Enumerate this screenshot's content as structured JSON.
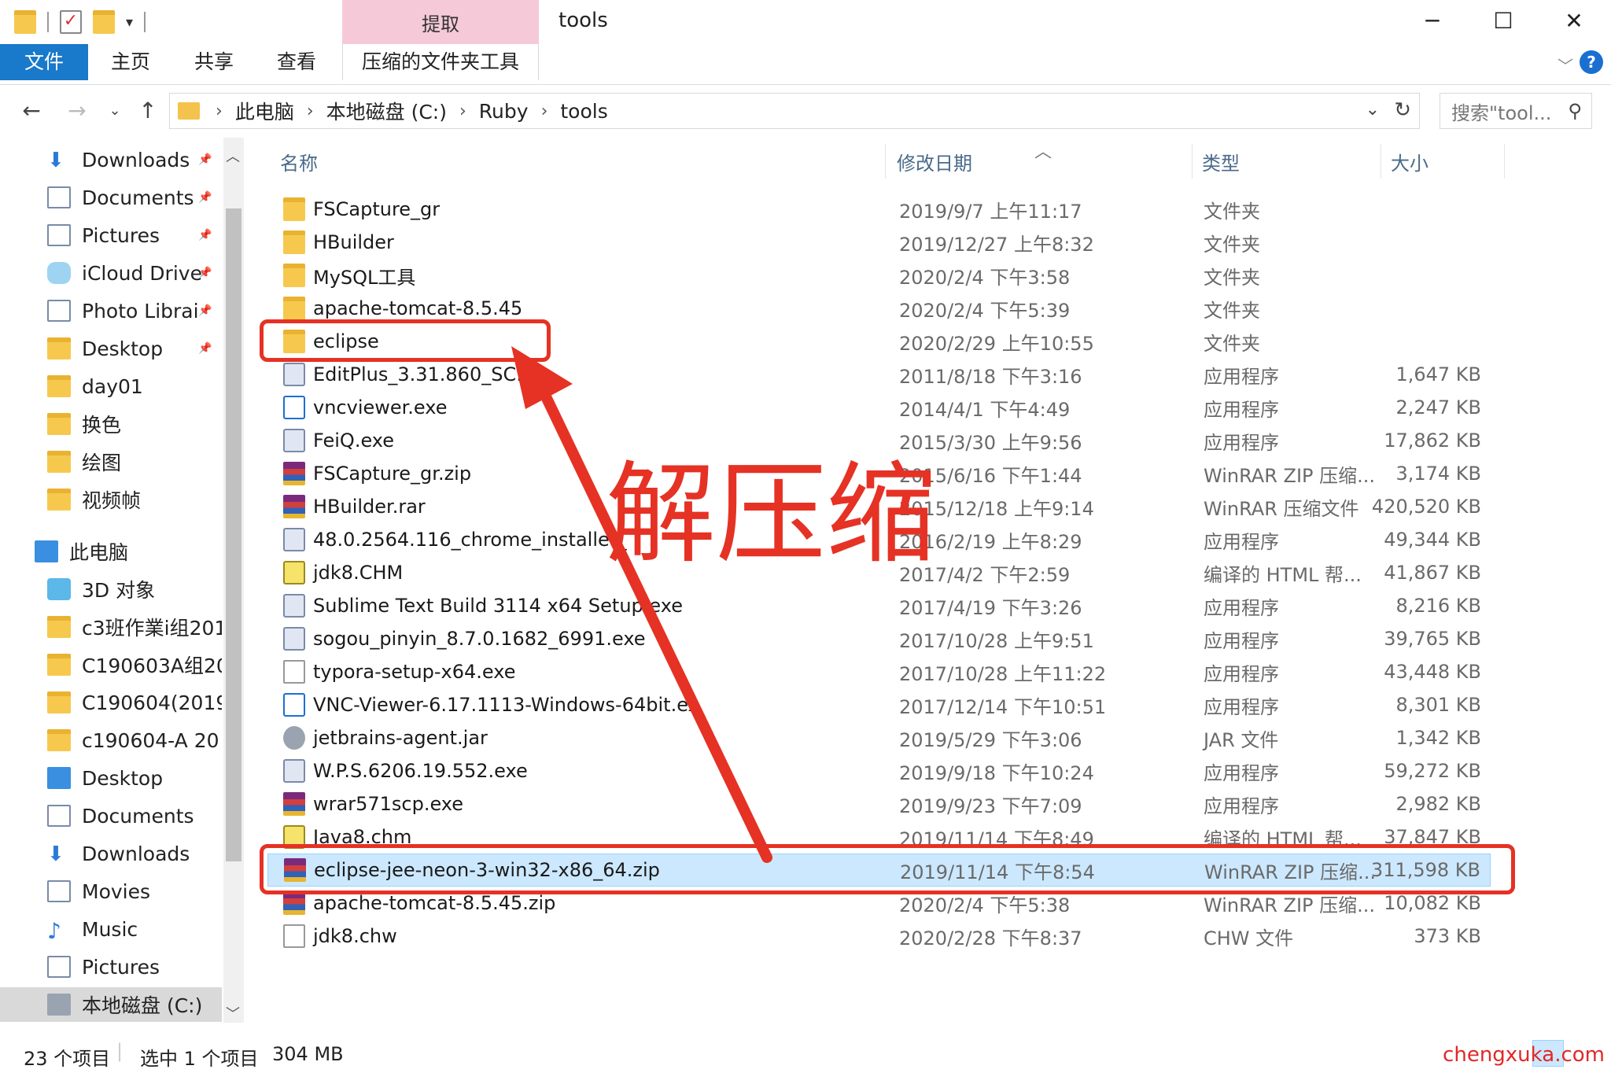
{
  "window": {
    "context_tab_label": "提取",
    "title": "tools"
  },
  "ribbon": {
    "tabs": [
      "文件",
      "主页",
      "共享",
      "查看"
    ],
    "context_tab": "压缩的文件夹工具"
  },
  "address": {
    "crumbs": [
      "此电脑",
      "本地磁盘 (C:)",
      "Ruby",
      "tools"
    ],
    "search_placeholder": "搜索\"tool..."
  },
  "nav": {
    "items": [
      {
        "label": "Downloads",
        "icon": "download-arrow-icon",
        "pinned": true
      },
      {
        "label": "Documents",
        "icon": "document-icon",
        "pinned": true
      },
      {
        "label": "Pictures",
        "icon": "picture-icon",
        "pinned": true
      },
      {
        "label": "iCloud Drive",
        "icon": "cloud-icon",
        "pinned": true
      },
      {
        "label": "Photo Librai",
        "icon": "photo-icon",
        "pinned": true
      },
      {
        "label": "Desktop",
        "icon": "folder-icon",
        "pinned": true
      },
      {
        "label": "day01",
        "icon": "folder-icon",
        "pinned": false
      },
      {
        "label": "换色",
        "icon": "folder-icon",
        "pinned": false
      },
      {
        "label": "绘图",
        "icon": "folder-icon",
        "pinned": false
      },
      {
        "label": "视频帧",
        "icon": "folder-icon",
        "pinned": false
      },
      {
        "label": "此电脑",
        "icon": "computer-icon",
        "pinned": false
      },
      {
        "label": "3D 对象",
        "icon": "cube-icon",
        "pinned": false
      },
      {
        "label": "c3班作業i组201",
        "icon": "folder-icon",
        "pinned": false
      },
      {
        "label": "C190603A组20",
        "icon": "folder-icon",
        "pinned": false
      },
      {
        "label": "C190604(2019",
        "icon": "folder-icon",
        "pinned": false
      },
      {
        "label": "c190604-A  20",
        "icon": "folder-icon",
        "pinned": false
      },
      {
        "label": "Desktop",
        "icon": "desktop-icon",
        "pinned": false
      },
      {
        "label": "Documents",
        "icon": "document-icon",
        "pinned": false
      },
      {
        "label": "Downloads",
        "icon": "download-arrow-icon",
        "pinned": false
      },
      {
        "label": "Movies",
        "icon": "film-icon",
        "pinned": false
      },
      {
        "label": "Music",
        "icon": "music-note-icon",
        "pinned": false
      },
      {
        "label": "Pictures",
        "icon": "picture-icon",
        "pinned": false
      },
      {
        "label": "本地磁盘 (C:)",
        "icon": "drive-icon",
        "pinned": false
      }
    ]
  },
  "columns": {
    "name": "名称",
    "date": "修改日期",
    "type": "类型",
    "size": "大小"
  },
  "files": [
    {
      "name": "FSCapture_gr",
      "date": "2019/9/7 上午11:17",
      "type": "文件夹",
      "size": "",
      "icon": "folder"
    },
    {
      "name": "HBuilder",
      "date": "2019/12/27 上午8:32",
      "type": "文件夹",
      "size": "",
      "icon": "folder"
    },
    {
      "name": "MySQL工具",
      "date": "2020/2/4 下午3:58",
      "type": "文件夹",
      "size": "",
      "icon": "folder"
    },
    {
      "name": "apache-tomcat-8.5.45",
      "date": "2020/2/4 下午5:39",
      "type": "文件夹",
      "size": "",
      "icon": "folder"
    },
    {
      "name": "eclipse",
      "date": "2020/2/29 上午10:55",
      "type": "文件夹",
      "size": "",
      "icon": "folder"
    },
    {
      "name": "EditPlus_3.31.860_SC.e",
      "date": "2011/8/18 下午3:16",
      "type": "应用程序",
      "size": "1,647 KB",
      "icon": "exe"
    },
    {
      "name": "vncviewer.exe",
      "date": "2014/4/1 下午4:49",
      "type": "应用程序",
      "size": "2,247 KB",
      "icon": "vnc"
    },
    {
      "name": "FeiQ.exe",
      "date": "2015/3/30 上午9:56",
      "type": "应用程序",
      "size": "17,862 KB",
      "icon": "exe"
    },
    {
      "name": "FSCapture_gr.zip",
      "date": "2015/6/16 下午1:44",
      "type": "WinRAR ZIP 压缩...",
      "size": "3,174 KB",
      "icon": "rar"
    },
    {
      "name": "HBuilder.rar",
      "date": "2015/12/18 上午9:14",
      "type": "WinRAR 压缩文件",
      "size": "420,520 KB",
      "icon": "rar"
    },
    {
      "name": "48.0.2564.116_chrome_installer_",
      "date": "2016/2/19 上午8:29",
      "type": "应用程序",
      "size": "49,344 KB",
      "icon": "exe"
    },
    {
      "name": "jdk8.CHM",
      "date": "2017/4/2 下午2:59",
      "type": "编译的 HTML 帮...",
      "size": "41,867 KB",
      "icon": "chm"
    },
    {
      "name": "Sublime Text Build 3114 x64 Setup.exe",
      "date": "2017/4/19 下午3:26",
      "type": "应用程序",
      "size": "8,216 KB",
      "icon": "exe"
    },
    {
      "name": "sogou_pinyin_8.7.0.1682_6991.exe",
      "date": "2017/10/28 上午9:51",
      "type": "应用程序",
      "size": "39,765 KB",
      "icon": "exe"
    },
    {
      "name": "typora-setup-x64.exe",
      "date": "2017/10/28 上午11:22",
      "type": "应用程序",
      "size": "43,448 KB",
      "icon": "doc"
    },
    {
      "name": "VNC-Viewer-6.17.1113-Windows-64bit.ex",
      "date": "2017/12/14 下午10:51",
      "type": "应用程序",
      "size": "8,301 KB",
      "icon": "vnc"
    },
    {
      "name": "jetbrains-agent.jar",
      "date": "2019/5/29 下午3:06",
      "type": "JAR 文件",
      "size": "1,342 KB",
      "icon": "jar"
    },
    {
      "name": "W.P.S.6206.19.552.exe",
      "date": "2019/9/18 下午10:24",
      "type": "应用程序",
      "size": "59,272 KB",
      "icon": "exe"
    },
    {
      "name": "wrar571scp.exe",
      "date": "2019/9/23 下午7:09",
      "type": "应用程序",
      "size": "2,982 KB",
      "icon": "rar"
    },
    {
      "name": "Java8.chm",
      "date": "2019/11/14 下午8:49",
      "type": "编译的 HTML 帮...",
      "size": "37,847 KB",
      "icon": "chm"
    },
    {
      "name": "eclipse-jee-neon-3-win32-x86_64.zip",
      "date": "2019/11/14 下午8:54",
      "type": "WinRAR ZIP 压缩...",
      "size": "311,598 KB",
      "icon": "rar",
      "selected": true
    },
    {
      "name": "apache-tomcat-8.5.45.zip",
      "date": "2020/2/4 下午5:38",
      "type": "WinRAR ZIP 压缩...",
      "size": "10,082 KB",
      "icon": "rar"
    },
    {
      "name": "jdk8.chw",
      "date": "2020/2/28 下午8:37",
      "type": "CHW 文件",
      "size": "373 KB",
      "icon": "doc"
    }
  ],
  "status": {
    "count": "23 个项目",
    "selection": "选中 1 个项目",
    "size": "304 MB",
    "watermark": "chengxuka.com"
  },
  "annotation": {
    "text": "解压缩",
    "color": "#e53224"
  }
}
